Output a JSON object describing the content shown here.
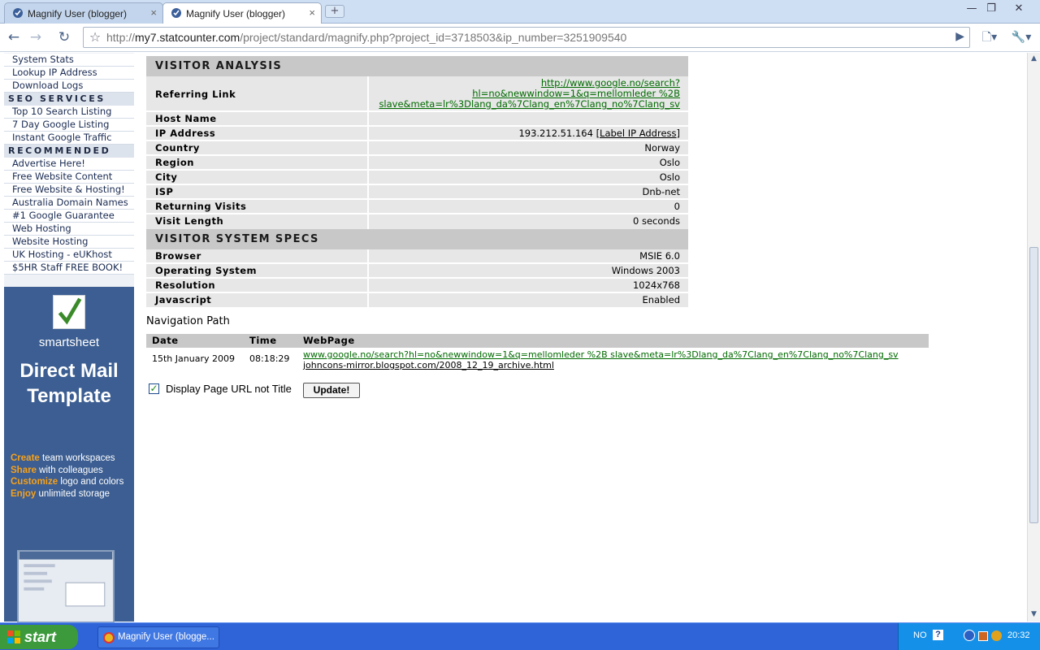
{
  "browser": {
    "tabs": [
      {
        "title": "Magnify User (blogger)",
        "close": "×"
      },
      {
        "title": "Magnify User (blogger)",
        "close": "×"
      }
    ],
    "new_tab": "+",
    "window_buttons": {
      "minimize": "—",
      "maximize": "❐",
      "close": "✕"
    },
    "url_host_prefix": "http://",
    "url_host": "my7.statcounter.com",
    "url_path": "/project/standard/magnify.php?project_id=3718503&ip_number=3251909540",
    "nav_icons": {
      "back": "←",
      "forward": "→",
      "reload": "↻",
      "star": "☆",
      "go": "▶",
      "page": "🗋▾",
      "tools": "🔧▾"
    }
  },
  "sidebar": {
    "group1": [
      "System Stats",
      "Lookup IP Address",
      "Download Logs"
    ],
    "seo_heading": "SEO SERVICES",
    "seo_items": [
      "Top 10 Search Listing",
      "7 Day Google Listing",
      "Instant Google Traffic"
    ],
    "rec_heading": "RECOMMENDED",
    "rec_items": [
      "Advertise Here!",
      "Free Website Content",
      "Free Website & Hosting!",
      "Australia Domain Names",
      "#1 Google Guarantee",
      "Web Hosting",
      "Website Hosting",
      "UK Hosting - eUKhost",
      "$5HR Staff FREE BOOK!"
    ]
  },
  "ad": {
    "brand": "smartsheet",
    "headline_line1": "Direct Mail",
    "headline_line2": "Template",
    "lines": [
      {
        "kw": "Create",
        "rest": " team workspaces"
      },
      {
        "kw": "Share",
        "rest": " with colleagues"
      },
      {
        "kw": "Customize",
        "rest": " logo and colors"
      },
      {
        "kw": "Enjoy",
        "rest": " unlimited storage"
      }
    ]
  },
  "visitor_analysis": {
    "heading": "VISITOR ANALYSIS",
    "referring_label": "Referring Link",
    "referring_lines": [
      "http://www.google.no/search?",
      "hl=no&newwindow=1&q=mellomleder %2B",
      "slave&meta=lr%3Dlang_da%7Clang_en%7Clang_no%7Clang_sv"
    ],
    "rows": [
      {
        "label": "Host Name",
        "value": ""
      },
      {
        "label": "IP Address",
        "value": "193.212.51.164",
        "link": "[Label IP Address]"
      },
      {
        "label": "Country",
        "value": "Norway"
      },
      {
        "label": "Region",
        "value": "Oslo"
      },
      {
        "label": "City",
        "value": "Oslo"
      },
      {
        "label": "ISP",
        "value": "Dnb-net"
      },
      {
        "label": "Returning Visits",
        "value": "0"
      },
      {
        "label": "Visit Length",
        "value": "0 seconds"
      }
    ]
  },
  "system_specs": {
    "heading": "VISITOR SYSTEM SPECS",
    "rows": [
      {
        "label": "Browser",
        "value": "MSIE 6.0"
      },
      {
        "label": "Operating System",
        "value": "Windows 2003"
      },
      {
        "label": "Resolution",
        "value": "1024x768"
      },
      {
        "label": "Javascript",
        "value": "Enabled"
      }
    ]
  },
  "navigation": {
    "title": "Navigation Path",
    "headers": {
      "date": "Date",
      "time": "Time",
      "webpage": "WebPage"
    },
    "entry": {
      "date": "15th January 2009",
      "time": "08:18:29",
      "link1": "www.google.no/search?hl=no&newwindow=1&q=mellomleder %2B slave&meta=lr%3Dlang_da%7Clang_en%7Clang_no%7Clang_sv",
      "link2": "johncons-mirror.blogspot.com/2008_12_19_archive.html"
    }
  },
  "display_option": {
    "label": "Display Page URL not Title",
    "checked_mark": "✓",
    "button": "Update!"
  },
  "scrollbar": {
    "up": "▲",
    "down": "▼"
  },
  "taskbar": {
    "start": "start",
    "task": "Magnify User (blogge...",
    "tray": {
      "lang": "NO",
      "help": "?",
      "clock": "20:32"
    }
  },
  "colors": {
    "link_green": "#006a00",
    "header_gray": "#c8c8c8",
    "row_gray": "#e7e7e7",
    "sidebar_blue": "#3c5e92",
    "ad_keyword_orange": "#f6a11c",
    "taskbar_blue": "#2f63d8"
  }
}
